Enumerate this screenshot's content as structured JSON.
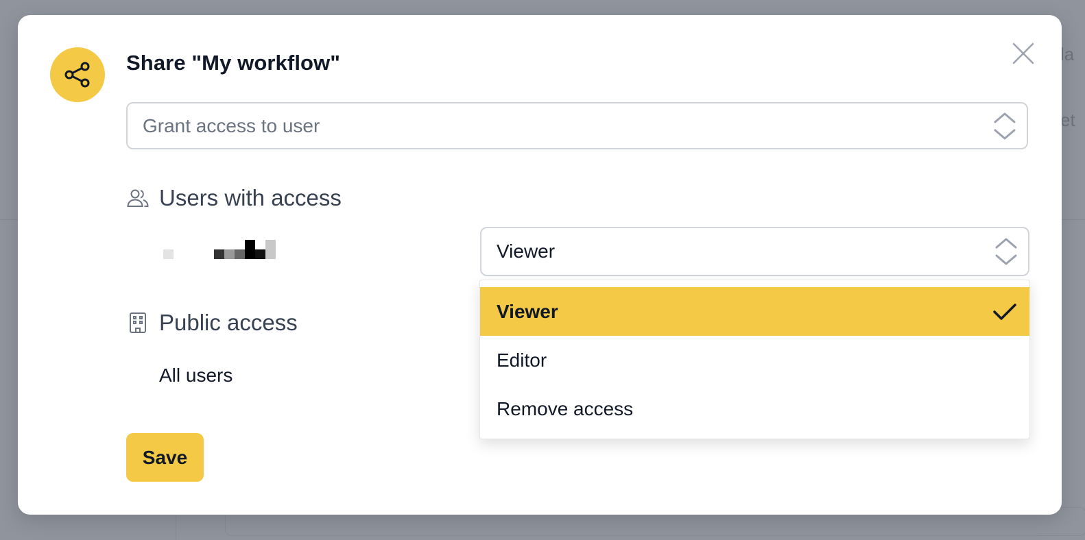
{
  "dialog": {
    "title": "Share \"My workflow\"",
    "grant_access": {
      "placeholder": "Grant access to user"
    },
    "users_section": {
      "heading": "Users with access",
      "users": [
        {
          "name_redacted": true,
          "role": "Viewer"
        }
      ]
    },
    "role_dropdown": {
      "selected": "Viewer",
      "options": [
        {
          "label": "Viewer",
          "selected": true
        },
        {
          "label": "Editor",
          "selected": false
        },
        {
          "label": "Remove access",
          "selected": false
        }
      ]
    },
    "public_section": {
      "heading": "Public access",
      "entry": "All users"
    },
    "save_label": "Save"
  },
  "colors": {
    "accent": "#f4c945",
    "backdrop": "#8f949d",
    "text": "#111827",
    "muted": "#6b7280",
    "border": "#d1d5db"
  },
  "icons": {
    "badge": "share-icon",
    "close": "close-icon",
    "select_arrows": "chevron-updown-icon",
    "users": "users-icon",
    "public": "building-icon",
    "checkmark": "check-icon"
  }
}
